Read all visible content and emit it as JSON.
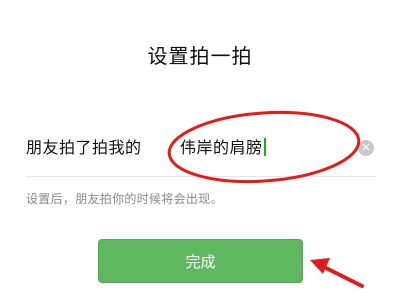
{
  "dialog": {
    "title": "设置拍一拍",
    "input": {
      "prefix": "朋友拍了拍我的",
      "value": "伟岸的肩膀"
    },
    "hint": "设置后，朋友拍你的时候将会出现。",
    "done_label": "完成"
  },
  "icons": {
    "clear": "clear-icon",
    "clear_glyph": "✕"
  },
  "colors": {
    "button": "#5fb860",
    "caret": "#1aad19",
    "annotation": "#e21b1b"
  }
}
